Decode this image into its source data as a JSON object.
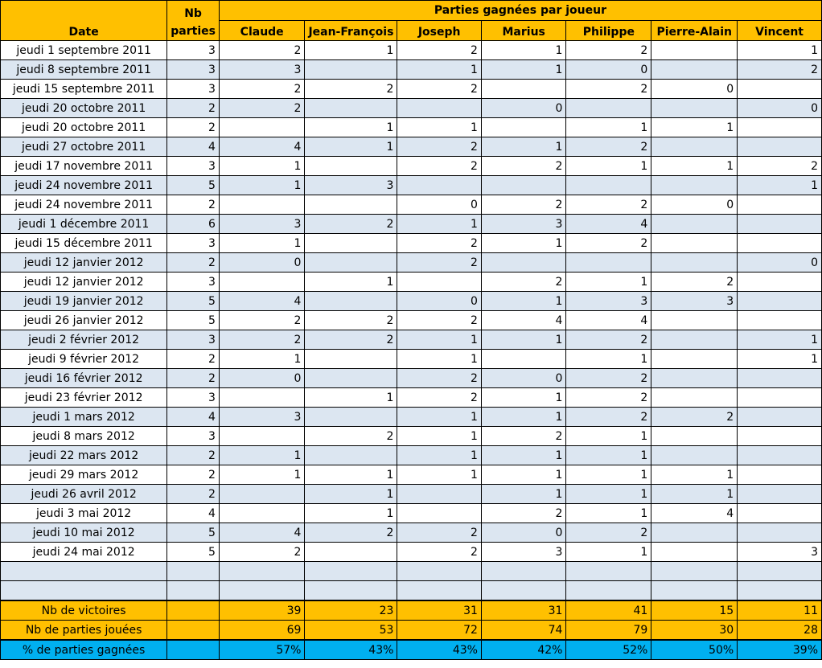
{
  "headers": {
    "date": "Date",
    "nb_parties": "Nb parties",
    "group": "Parties gagnées par joueur",
    "players": [
      "Claude",
      "Jean-François",
      "Joseph",
      "Marius",
      "Philippe",
      "Pierre-Alain",
      "Vincent"
    ]
  },
  "rows": [
    {
      "date": "jeudi 1 septembre 2011",
      "nb": "3",
      "scores": [
        "2",
        "1",
        "2",
        "1",
        "2",
        "",
        "1"
      ]
    },
    {
      "date": "jeudi 8 septembre 2011",
      "nb": "3",
      "scores": [
        "3",
        "",
        "1",
        "1",
        "0",
        "",
        "2"
      ]
    },
    {
      "date": "jeudi 15 septembre 2011",
      "nb": "3",
      "scores": [
        "2",
        "2",
        "2",
        "",
        "2",
        "0",
        ""
      ]
    },
    {
      "date": "jeudi 20 octobre 2011",
      "nb": "2",
      "scores": [
        "2",
        "",
        "",
        "0",
        "",
        "",
        "0"
      ]
    },
    {
      "date": "jeudi 20 octobre 2011",
      "nb": "2",
      "scores": [
        "",
        "1",
        "1",
        "",
        "1",
        "1",
        ""
      ]
    },
    {
      "date": "jeudi 27 octobre 2011",
      "nb": "4",
      "scores": [
        "4",
        "1",
        "2",
        "1",
        "2",
        "",
        ""
      ]
    },
    {
      "date": "jeudi 17 novembre 2011",
      "nb": "3",
      "scores": [
        "1",
        "",
        "2",
        "2",
        "1",
        "1",
        "2"
      ]
    },
    {
      "date": "jeudi 24 novembre 2011",
      "nb": "5",
      "scores": [
        "1",
        "3",
        "",
        "",
        "",
        "",
        "1"
      ]
    },
    {
      "date": "jeudi 24 novembre 2011",
      "nb": "2",
      "scores": [
        "",
        "",
        "0",
        "2",
        "2",
        "0",
        ""
      ]
    },
    {
      "date": "jeudi 1 décembre 2011",
      "nb": "6",
      "scores": [
        "3",
        "2",
        "1",
        "3",
        "4",
        "",
        ""
      ]
    },
    {
      "date": "jeudi 15 décembre 2011",
      "nb": "3",
      "scores": [
        "1",
        "",
        "2",
        "1",
        "2",
        "",
        ""
      ]
    },
    {
      "date": "jeudi 12 janvier 2012",
      "nb": "2",
      "scores": [
        "0",
        "",
        "2",
        "",
        "",
        "",
        "0"
      ]
    },
    {
      "date": "jeudi 12 janvier 2012",
      "nb": "3",
      "scores": [
        "",
        "1",
        "",
        "2",
        "1",
        "2",
        ""
      ]
    },
    {
      "date": "jeudi 19 janvier 2012",
      "nb": "5",
      "scores": [
        "4",
        "",
        "0",
        "1",
        "3",
        "3",
        ""
      ]
    },
    {
      "date": "jeudi 26 janvier 2012",
      "nb": "5",
      "scores": [
        "2",
        "2",
        "2",
        "4",
        "4",
        "",
        ""
      ]
    },
    {
      "date": "jeudi 2 février 2012",
      "nb": "3",
      "scores": [
        "2",
        "2",
        "1",
        "1",
        "2",
        "",
        "1"
      ]
    },
    {
      "date": "jeudi 9 février 2012",
      "nb": "2",
      "scores": [
        "1",
        "",
        "1",
        "",
        "1",
        "",
        "1"
      ]
    },
    {
      "date": "jeudi 16 février 2012",
      "nb": "2",
      "scores": [
        "0",
        "",
        "2",
        "0",
        "2",
        "",
        ""
      ]
    },
    {
      "date": "jeudi 23 février 2012",
      "nb": "3",
      "scores": [
        "",
        "1",
        "2",
        "1",
        "2",
        "",
        ""
      ]
    },
    {
      "date": "jeudi 1 mars 2012",
      "nb": "4",
      "scores": [
        "3",
        "",
        "1",
        "1",
        "2",
        "2",
        ""
      ]
    },
    {
      "date": "jeudi 8 mars 2012",
      "nb": "3",
      "scores": [
        "",
        "2",
        "1",
        "2",
        "1",
        "",
        ""
      ]
    },
    {
      "date": "jeudi 22 mars 2012",
      "nb": "2",
      "scores": [
        "1",
        "",
        "1",
        "1",
        "1",
        "",
        ""
      ]
    },
    {
      "date": "jeudi 29 mars 2012",
      "nb": "2",
      "scores": [
        "1",
        "1",
        "1",
        "1",
        "1",
        "1",
        ""
      ]
    },
    {
      "date": "jeudi 26 avril 2012",
      "nb": "2",
      "scores": [
        "",
        "1",
        "",
        "1",
        "1",
        "1",
        ""
      ]
    },
    {
      "date": "jeudi 3 mai 2012",
      "nb": "4",
      "scores": [
        "",
        "1",
        "",
        "2",
        "1",
        "4",
        ""
      ]
    },
    {
      "date": "jeudi 10 mai 2012",
      "nb": "5",
      "scores": [
        "4",
        "2",
        "2",
        "0",
        "2",
        "",
        ""
      ]
    },
    {
      "date": "jeudi 24 mai 2012",
      "nb": "5",
      "scores": [
        "2",
        "",
        "2",
        "3",
        "1",
        "",
        "3"
      ]
    }
  ],
  "totals": {
    "victoires_label": "Nb de victoires",
    "victoires": [
      "39",
      "23",
      "31",
      "31",
      "41",
      "15",
      "11"
    ],
    "jouees_label": "Nb de parties jouées",
    "jouees": [
      "69",
      "53",
      "72",
      "74",
      "79",
      "30",
      "28"
    ],
    "pct_label": "% de parties gagnées",
    "pct": [
      "57%",
      "43%",
      "43%",
      "42%",
      "52%",
      "50%",
      "39%"
    ]
  },
  "colors": {
    "header": "#ffc000",
    "band": "#dce6f1",
    "pct_row": "#00b0f0"
  }
}
